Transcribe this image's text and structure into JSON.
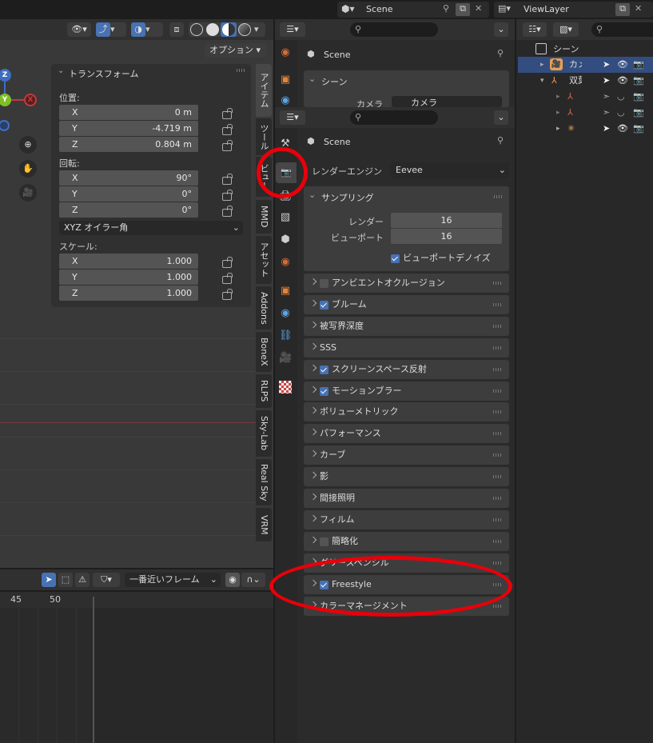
{
  "topbar": {
    "scene_label": "Scene",
    "viewlayer_label": "ViewLayer"
  },
  "viewport": {
    "options_label": "オプション",
    "tabs": [
      "アイテム",
      "ツール",
      "ビュー",
      "MMD",
      "アセット",
      "Addons",
      "BoneX",
      "RLPS",
      "Sky-Lab",
      "Real Sky",
      "VRM"
    ]
  },
  "transform": {
    "title": "トランスフォーム",
    "location_label": "位置:",
    "location": [
      {
        "axis": "X",
        "value": "0 m"
      },
      {
        "axis": "Y",
        "value": "-4.719 m"
      },
      {
        "axis": "Z",
        "value": "0.804 m"
      }
    ],
    "rotation_label": "回転:",
    "rotation": [
      {
        "axis": "X",
        "value": "90°"
      },
      {
        "axis": "Y",
        "value": "0°"
      },
      {
        "axis": "Z",
        "value": "0°"
      }
    ],
    "mode": "XYZ オイラー角",
    "scale_label": "スケール:",
    "scale": [
      {
        "axis": "X",
        "value": "1.000"
      },
      {
        "axis": "Y",
        "value": "1.000"
      },
      {
        "axis": "Z",
        "value": "1.000"
      }
    ]
  },
  "timeline": {
    "snap_label": "一番近いフレーム",
    "ticks": [
      "45",
      "50"
    ]
  },
  "properties_back": {
    "scene_name": "Scene",
    "section": "シーン",
    "camera_label": "カメラ",
    "camera_value": "カメラ"
  },
  "properties": {
    "scene_name": "Scene",
    "engine_label": "レンダーエンジン",
    "engine_value": "Eevee",
    "sampling": {
      "title": "サンプリング",
      "render_label": "レンダー",
      "render_value": "16",
      "viewport_label": "ビューポート",
      "viewport_value": "16",
      "denoise_label": "ビューポートデノイズ"
    },
    "panels": [
      {
        "label": "アンビエントオクルージョン",
        "checkbox": "off"
      },
      {
        "label": "ブルーム",
        "checkbox": "on"
      },
      {
        "label": "被写界深度",
        "checkbox": "none"
      },
      {
        "label": "SSS",
        "checkbox": "none"
      },
      {
        "label": "スクリーンスペース反射",
        "checkbox": "on"
      },
      {
        "label": "モーションブラー",
        "checkbox": "on"
      },
      {
        "label": "ボリューメトリック",
        "checkbox": "none"
      },
      {
        "label": "パフォーマンス",
        "checkbox": "none"
      },
      {
        "label": "カーブ",
        "checkbox": "none"
      },
      {
        "label": "影",
        "checkbox": "none"
      },
      {
        "label": "間接照明",
        "checkbox": "none"
      },
      {
        "label": "フィルム",
        "checkbox": "none"
      },
      {
        "label": "簡略化",
        "checkbox": "off"
      },
      {
        "label": "グリースペンシル",
        "checkbox": "none"
      },
      {
        "label": "Freestyle",
        "checkbox": "on"
      },
      {
        "label": "カラーマネージメント",
        "checkbox": "none"
      }
    ]
  },
  "outliner": {
    "rows": [
      {
        "label": "シーン"
      },
      {
        "label": "カメラ"
      },
      {
        "label": "双葉"
      },
      {
        "label": ""
      },
      {
        "label": ""
      },
      {
        "label": ""
      }
    ]
  },
  "colors": {
    "accent": "#4772b3",
    "highlight": "#e8000a"
  }
}
